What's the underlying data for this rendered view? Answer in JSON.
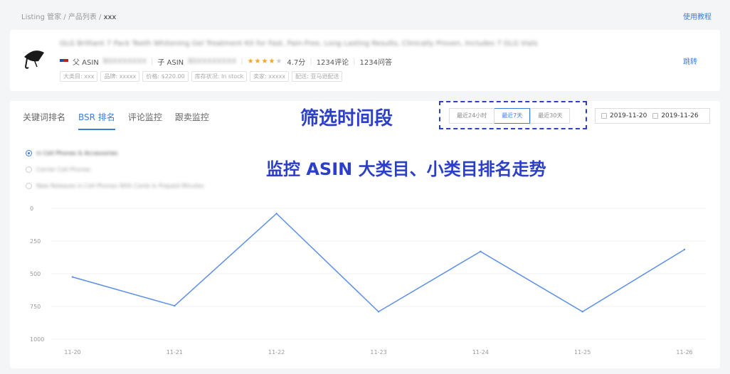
{
  "breadcrumb": {
    "part1": "Listing 管家",
    "sep1": " / ",
    "part2": "产品列表",
    "sep2": " / ",
    "current": "xxx"
  },
  "help_link": "使用教程",
  "product": {
    "image_icon": "umbrella-icon",
    "title": "GLG Brilliant 7 Pack Teeth Whitening Gel Treatment Kit for Fast, Pain-Free, Long Lasting Results, Clinically Proven, Includes 7 GLG Vials",
    "parent_asin_label": "父 ASIN",
    "parent_asin": "B0XXXXXXX",
    "child_asin_label": "子 ASIN",
    "child_asin": "B0XXXXXXXX",
    "rating_stars": 4,
    "rating_text": "4.7分",
    "reviews": "1234评论",
    "qa": "1234问答",
    "tags": [
      "大类目: xxx",
      "品牌: xxxxx",
      "价格: $220.00",
      "库存状况: In stock",
      "卖家: xxxxx",
      "配送: 亚马逊配送"
    ],
    "link_label": "跳转"
  },
  "tabs": [
    "关键词排名",
    "BSR 排名",
    "评论监控",
    "跟卖监控"
  ],
  "active_tab": 1,
  "annotations": {
    "period": "筛选时间段",
    "asin": "监控 ASIN 大类目、小类目排名走势"
  },
  "range_buttons": [
    "最近24小时",
    "最近7天",
    "最近30天"
  ],
  "active_range": 1,
  "date_range": {
    "start": "2019-11-20",
    "end": "2019-11-26"
  },
  "categories": [
    {
      "label": "in Cell Phones & Accessories",
      "checked": true
    },
    {
      "label": "Carrier Cell Phones",
      "checked": false
    },
    {
      "label": "New Releases in Cell Phones With Cards & Prepaid Minutes",
      "checked": false
    }
  ],
  "colors": {
    "accent": "#3b7ddd",
    "annotation": "#2c3fc8",
    "line": "#5b8fe6"
  },
  "chart_data": {
    "type": "line",
    "x": [
      "11-20",
      "11-21",
      "11-22",
      "11-23",
      "11-24",
      "11-25",
      "11-26"
    ],
    "series": [
      {
        "values": [
          525,
          745,
          40,
          790,
          330,
          790,
          315
        ]
      }
    ],
    "yticks": [
      0,
      250,
      500,
      750,
      1000
    ],
    "ylim": [
      0,
      1000
    ],
    "y_inverted": true,
    "grid": true
  }
}
